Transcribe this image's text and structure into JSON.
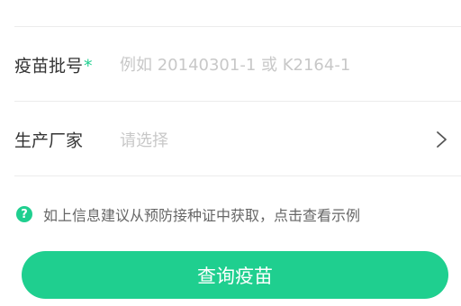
{
  "form": {
    "batch_number": {
      "label": "疫苗批号",
      "required_mark": "*",
      "value": "",
      "placeholder": "例如 20140301-1 或 K2164-1"
    },
    "manufacturer": {
      "label": "生产厂家",
      "value": "请选择",
      "chevron_icon": "chevron-right-icon"
    }
  },
  "hint": {
    "icon": "question-circle-icon",
    "icon_glyph": "?",
    "text": "如上信息建议从预防接种证中获取，点击查看示例"
  },
  "submit": {
    "label": "查询疫苗"
  },
  "colors": {
    "accent": "#1fcf8f",
    "placeholder": "#c8c8c8",
    "label": "#333333",
    "hint_text": "#666666",
    "divider": "#ececec"
  }
}
